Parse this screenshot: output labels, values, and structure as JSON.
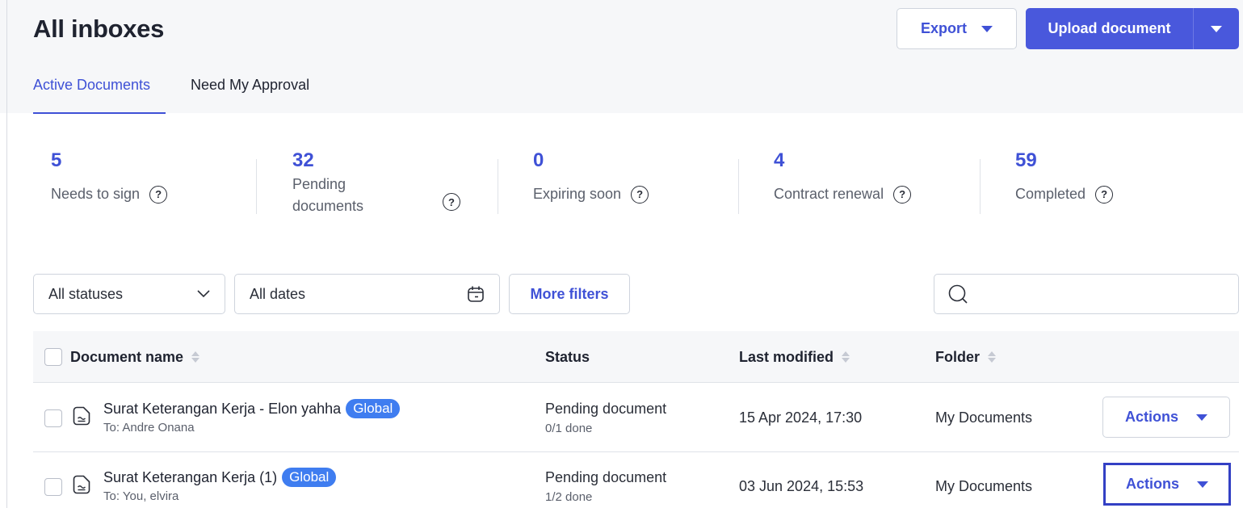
{
  "page": {
    "title": "All inboxes"
  },
  "header": {
    "export_label": "Export",
    "upload_label": "Upload document"
  },
  "tabs": [
    {
      "label": "Active Documents",
      "active": true
    },
    {
      "label": "Need My Approval",
      "active": false
    }
  ],
  "stats": [
    {
      "value": "5",
      "label": "Needs to sign"
    },
    {
      "value": "32",
      "label": "Pending documents"
    },
    {
      "value": "0",
      "label": "Expiring soon"
    },
    {
      "value": "4",
      "label": "Contract renewal"
    },
    {
      "value": "59",
      "label": "Completed"
    }
  ],
  "filters": {
    "status": "All statuses",
    "date": "All dates",
    "more_label": "More filters",
    "search_value": ""
  },
  "table": {
    "columns": [
      "Document name",
      "Status",
      "Last modified",
      "Folder"
    ],
    "rows": [
      {
        "name": "Surat Keterangan Kerja - Elon yahha",
        "badge": "Global",
        "recipient": "To: Andre Onana",
        "status": "Pending document",
        "progress": "0/1 done",
        "modified": "15 Apr 2024, 17:30",
        "folder": "My Documents",
        "action_label": "Actions"
      },
      {
        "name": "Surat Keterangan Kerja (1)",
        "badge": "Global",
        "recipient": "To: You, elvira",
        "status": "Pending document",
        "progress": "1/2 done",
        "modified": "03 Jun 2024, 15:53",
        "folder": "My Documents",
        "action_label": "Actions"
      }
    ]
  },
  "colors": {
    "accent": "#3f51d6",
    "primary_button": "#4958dc",
    "badge": "#3f7df0",
    "focus_outline": "#3340c4"
  }
}
